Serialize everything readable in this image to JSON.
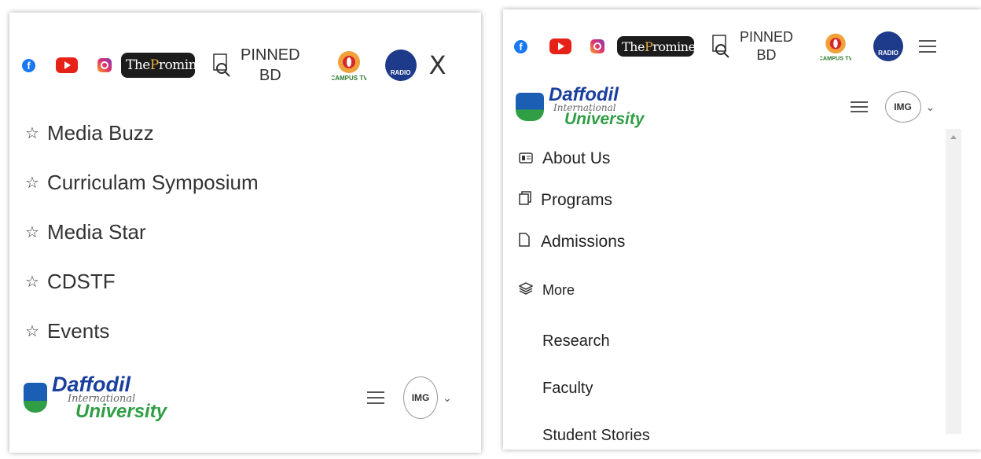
{
  "social": {
    "facebook_letter": "f",
    "prominent_the": "The ",
    "prominent_p": "P",
    "prominent_rest": "rominent",
    "pinned_line1": "PINNED",
    "pinned_line2": "BD",
    "campus_label": "CAMPUS TV",
    "radio_label": "RADIO",
    "icons": [
      "facebook-icon",
      "youtube-icon",
      "instagram-icon",
      "the-prominent-logo",
      "pinned-bd-icon",
      "campus-tv-logo",
      "radio-logo"
    ]
  },
  "left_panel": {
    "close_glyph": "X",
    "menu_items": [
      "Media Buzz",
      "Curriculam Symposium",
      "Media Star",
      "CDSTF",
      "Events"
    ],
    "star_glyph": "☆"
  },
  "brand": {
    "line1": "Daffodil",
    "line2": "International",
    "line3": "University",
    "avatar_alt": "IMG",
    "chevron": "⌄"
  },
  "right_panel": {
    "items": [
      {
        "label": "About Us",
        "icon": "id-card-icon"
      },
      {
        "label": "Programs",
        "icon": "copy-icon"
      },
      {
        "label": "Admissions",
        "icon": "file-icon"
      },
      {
        "label": "More",
        "icon": "layers-icon"
      }
    ],
    "sub_items": [
      "Research",
      "Faculty",
      "Student Stories"
    ]
  },
  "colors": {
    "daffodil_blue": "#1a3f9c",
    "daffodil_green": "#2f9e44",
    "youtube_red": "#e62117",
    "facebook_blue": "#1877f2"
  }
}
